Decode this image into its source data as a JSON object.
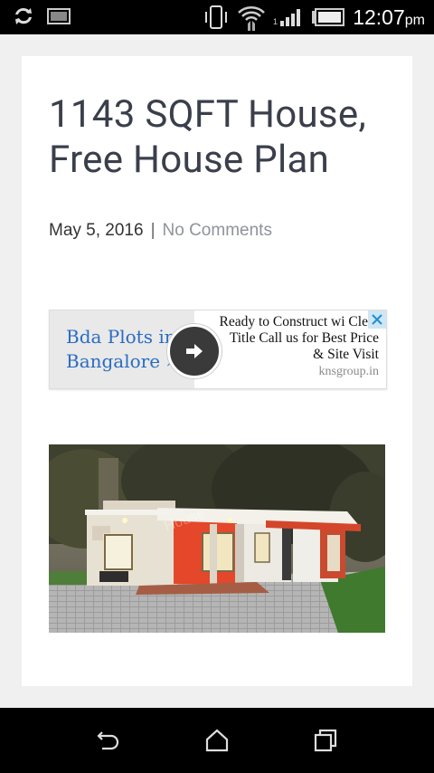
{
  "status_bar": {
    "time": "12:07",
    "ampm": "pm",
    "icons": [
      "sync-icon",
      "image-notification-icon",
      "vibrate-icon",
      "wifi-icon",
      "signal-icon",
      "battery-icon"
    ]
  },
  "article": {
    "title": "1143 SQFT House, Free House Plan",
    "date": "May 5, 2016",
    "separator": "|",
    "comments": "No Comments"
  },
  "ad": {
    "headline": "Bda Plots in Bangalore »",
    "body": "Ready to Construct wi Clear Title Call us for Best Price & Site Visit",
    "domain": "knsgroup.in",
    "arrow_icon": "arrow-right-icon",
    "close_icon": "close-icon"
  },
  "image": {
    "watermark": "House"
  },
  "nav_bar": {
    "icons": [
      "back-icon",
      "home-icon",
      "recents-icon"
    ]
  },
  "colors": {
    "title": "#3a3f4b",
    "link_muted": "#8f939a",
    "ad_link": "#2a6cc2"
  }
}
